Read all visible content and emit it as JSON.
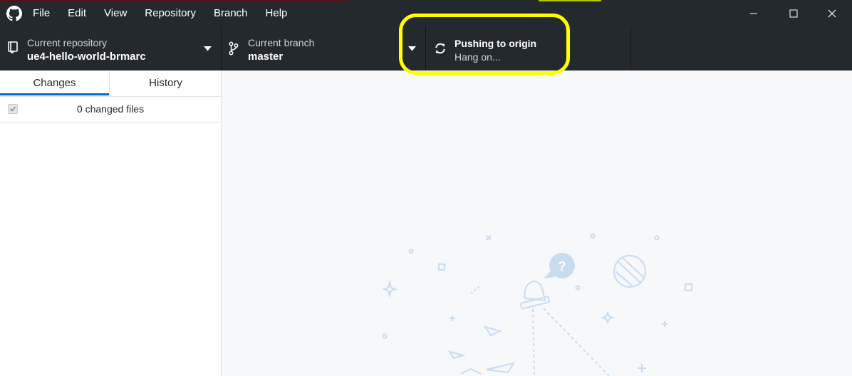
{
  "menu": {
    "items": [
      {
        "label": "File"
      },
      {
        "label": "Edit"
      },
      {
        "label": "View"
      },
      {
        "label": "Repository"
      },
      {
        "label": "Branch"
      },
      {
        "label": "Help"
      }
    ]
  },
  "toolbar": {
    "repository": {
      "label": "Current repository",
      "value": "ue4-hello-world-brmarc"
    },
    "branch": {
      "label": "Current branch",
      "value": "master"
    },
    "push": {
      "title": "Pushing to origin",
      "status": "Hang on..."
    }
  },
  "sidebar": {
    "tabs": [
      {
        "label": "Changes",
        "selected": true
      },
      {
        "label": "History",
        "selected": false
      }
    ],
    "changed_files_label": "0 changed files"
  },
  "colors": {
    "titlebar": "#24292e",
    "accent": "#0366d6",
    "highlight": "#ffff00",
    "illustration": "#c8dcf0"
  },
  "icons": [
    "github-logo-icon",
    "minimize-icon",
    "maximize-icon",
    "close-icon",
    "repo-icon",
    "caret-down-icon",
    "branch-icon",
    "sync-icon"
  ]
}
